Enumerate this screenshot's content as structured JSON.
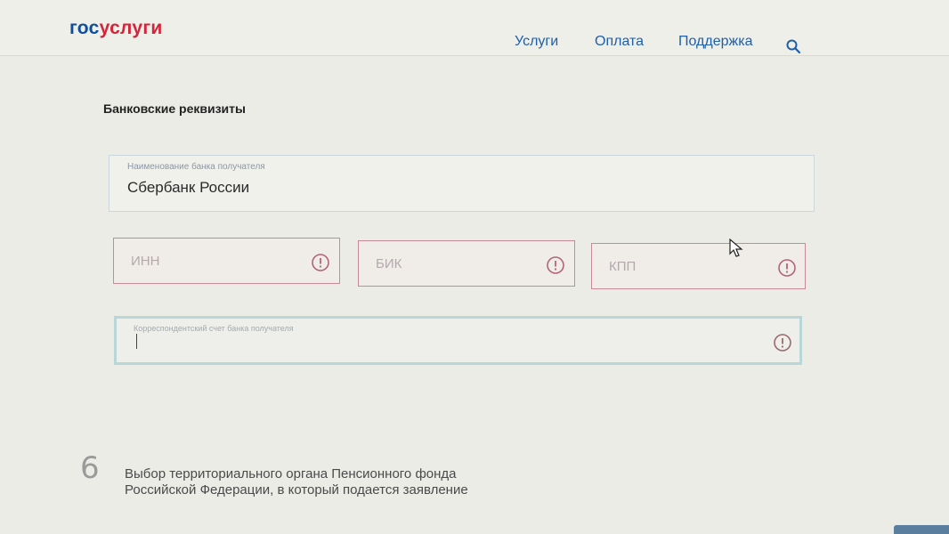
{
  "header": {
    "logo_part1": "гос",
    "logo_part2": "услуги",
    "nav": [
      "Услуги",
      "Оплата",
      "Поддержка"
    ],
    "search_icon": "search-icon"
  },
  "section": {
    "title": "Банковские реквизиты"
  },
  "form": {
    "bank_name": {
      "label": "Наименование банка получателя",
      "value": "Сбербанк России"
    },
    "inn": {
      "placeholder": "ИНН",
      "icon": "warning-icon"
    },
    "bik": {
      "placeholder": "БИК",
      "icon": "warning-icon"
    },
    "kpp": {
      "placeholder": "КПП",
      "icon": "warning-icon"
    },
    "corr_account": {
      "label": "Корреспондентский счет банка получателя",
      "value": "",
      "icon": "warning-icon"
    }
  },
  "next_step": {
    "number": "6",
    "line1": "Выбор территориального органа Пенсионного фонда",
    "line2": "Российской Федерации, в который подается заявление"
  },
  "colors": {
    "brand_blue": "#0d4f9c",
    "brand_red": "#d4243a",
    "error_border": "#c98a98",
    "focus_border": "#b9d7d8"
  }
}
